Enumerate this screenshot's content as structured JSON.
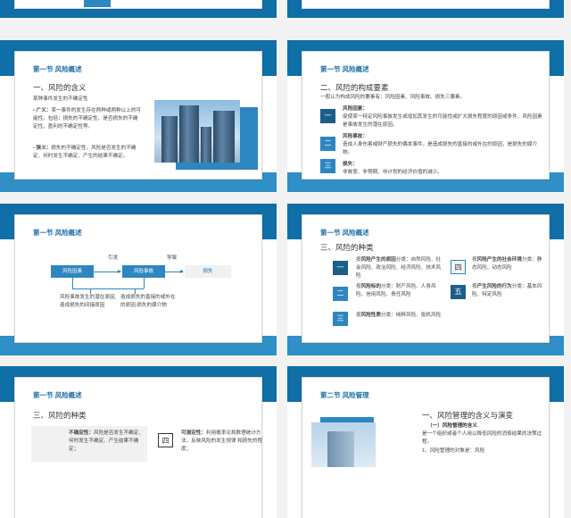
{
  "s3": {
    "section": "第一节 风险概述",
    "heading": "一、风险的含义",
    "subtitle": "某种事件发生的不确定性",
    "items": [
      {
        "term": "广义：",
        "text": "某一事件的发生存在两种或两种以上的可能性。包括：损失的不确定性、是否损失的不确定性、盈利的不确定性等。"
      },
      {
        "term": "狭义：",
        "text": "损失的不确定性，风险是否发生的不确定、何时发生不确定、产生的结果不确定。"
      }
    ]
  },
  "s4": {
    "section": "第一节 风险概述",
    "heading": "二、风险的构成要素",
    "intro": "一般认为构成风险的要素有：风险因素、风险事故、损失三要素。",
    "items": [
      {
        "num": "一",
        "title": "风险因素：",
        "text": "促使某一特定风险事故发生或增加其发生的可能性或扩大损失程度的原因或条件，风险因素是事故发生的潜在原因。"
      },
      {
        "num": "二",
        "title": "风险事故：",
        "text": "造成人身伤害或财产损失的偶发事件，是造成损失的直接的或外在的原因，是损失的媒介物。"
      },
      {
        "num": "三",
        "title": "损失：",
        "text": "非故意、非预期、非计划的经济价值的减少。"
      }
    ]
  },
  "s5": {
    "section": "第一节 风险概述",
    "flow": [
      "风险因素",
      "风险事故",
      "损失"
    ],
    "arrow1": "引发",
    "arrow2": "导致",
    "note1": "风险事故发生的潜在原因,造成损失的间接原因",
    "note2": "造成损失的直接的或外在的原因,损失的媒介物"
  },
  "s6": {
    "section": "第一节 风险概述",
    "heading": "三、风险的种类",
    "items": [
      {
        "num": "一",
        "pre": "按",
        "bold": "风险产生的原因",
        "post": "分类：自然风险、社会风险、政治风险、经济风险、技术风险"
      },
      {
        "num": "二",
        "pre": "按",
        "bold": "风险标的",
        "post": "分类：财产风险、人身风险、信用风险、责任风险"
      },
      {
        "num": "三",
        "pre": "按",
        "bold": "风险性质",
        "post": "分类：纯粹风险、投机风险"
      },
      {
        "num": "四",
        "pre": "按",
        "bold": "风险产生的社会环境",
        "post": "分类：静态风险、动态风险"
      },
      {
        "num": "五",
        "pre": "按",
        "bold": "产生风险的行为",
        "post": "分类：基本风险、特定风险"
      }
    ]
  },
  "s7": {
    "section": "第一节 风险概述",
    "heading": "三、风险的种类",
    "left_title": "不确定性：",
    "left_text": "风险是否发生不确定、何时发生不确定、产生结果不确定；",
    "num": "四",
    "right_title": "可测定性：",
    "right_text": "利用概率论和数理统计方法，反映风险的发生规律 和损失的程度；"
  },
  "s8": {
    "section": "第二节 风险管理",
    "heading": "一、风险管理的含义与演变",
    "sub": "（一）风险管理的含义",
    "text": "是一个组织或者个人用以降低风险的消极结果的决策过程。",
    "point": "1、风险管理的对象是：风险"
  }
}
